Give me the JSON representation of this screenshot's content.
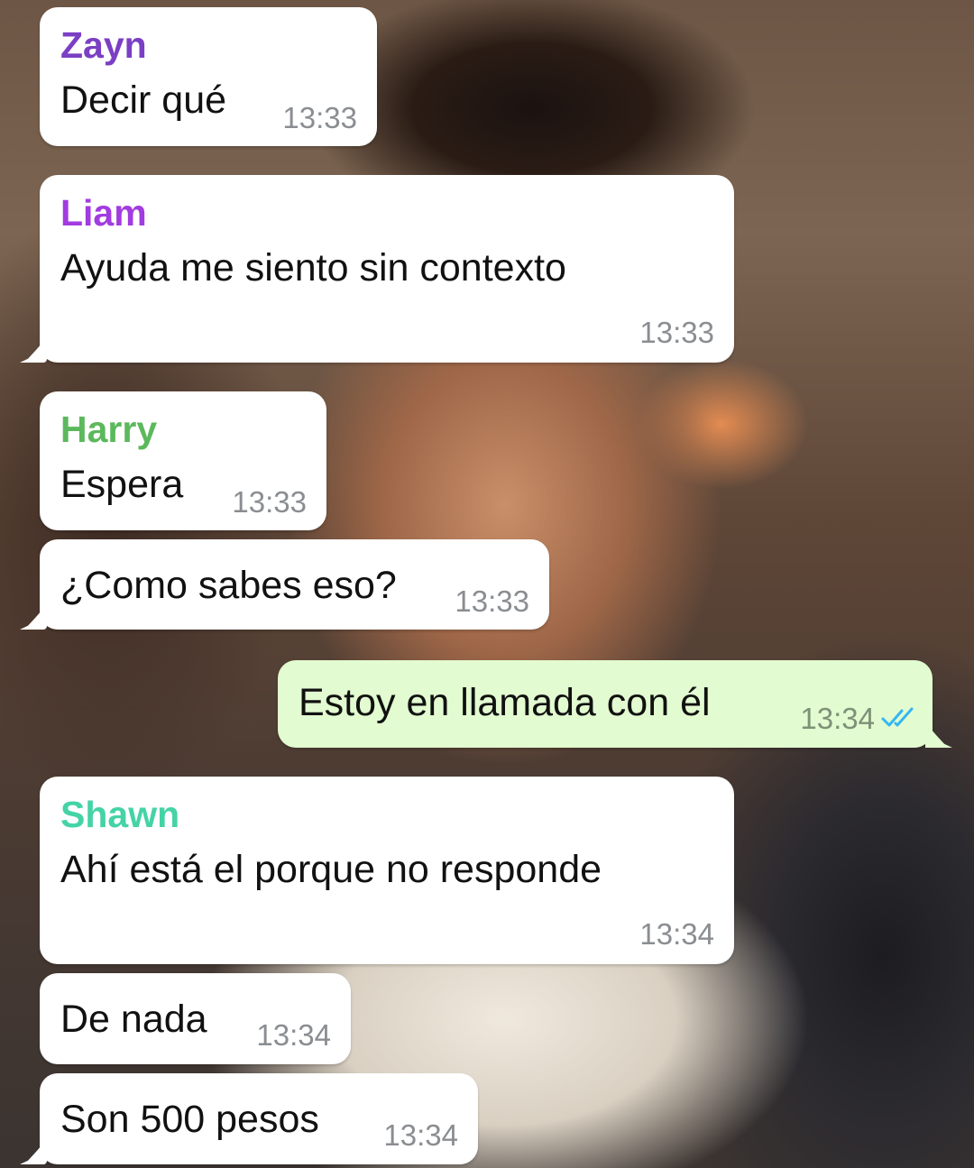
{
  "colors": {
    "incoming_bubble": "#ffffff",
    "outgoing_bubble": "#e2fbd0",
    "timestamp": "#8a8d91",
    "read_ticks": "#34b7f1",
    "zayn": "#7b3fc4",
    "liam": "#a23be0",
    "harry": "#5cb85c",
    "shawn": "#45d3a6"
  },
  "messages": [
    {
      "sender": "Zayn",
      "text": "Decir qué",
      "time": "13:33"
    },
    {
      "sender": "Liam",
      "text": "Ayuda me siento sin contexto",
      "time": "13:33"
    },
    {
      "sender": "Harry",
      "text": "Espera",
      "time": "13:33"
    },
    {
      "sender": "",
      "text": "¿Como sabes eso?",
      "time": "13:33"
    },
    {
      "sender": "",
      "text": "Estoy en llamada con él",
      "time": "13:34",
      "outgoing": true,
      "status_icon": "double-check-read-icon"
    },
    {
      "sender": "Shawn",
      "text": "Ahí está el porque no responde",
      "time": "13:34"
    },
    {
      "sender": "",
      "text": "De nada",
      "time": "13:34"
    },
    {
      "sender": "",
      "text": "Son 500 pesos",
      "time": "13:34"
    }
  ]
}
